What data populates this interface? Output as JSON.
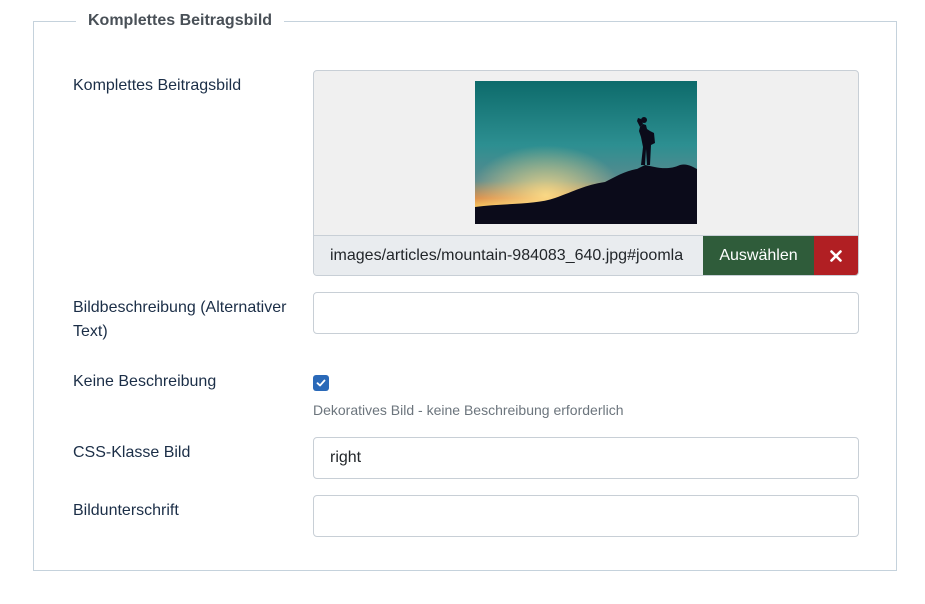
{
  "fieldset": {
    "legend": "Komplettes Beitragsbild"
  },
  "image_field": {
    "label": "Komplettes Beitragsbild",
    "path_value": "images/articles/mountain-984083_640.jpg#joomla",
    "select_label": "Auswählen",
    "clear_icon": "close-icon"
  },
  "alt_field": {
    "label": "Bildbeschreibung (Alternativer Text)",
    "value": ""
  },
  "no_desc": {
    "label": "Keine Beschreibung",
    "checked": true,
    "help": "Dekoratives Bild - keine Beschreibung erforderlich"
  },
  "css_class": {
    "label": "CSS-Klasse Bild",
    "value": "right"
  },
  "caption": {
    "label": "Bildunterschrift",
    "value": ""
  },
  "colors": {
    "select_button": "#2f5c3a",
    "clear_button": "#b11f23",
    "checkbox": "#2a69b8",
    "label_text": "#1b2e47"
  }
}
